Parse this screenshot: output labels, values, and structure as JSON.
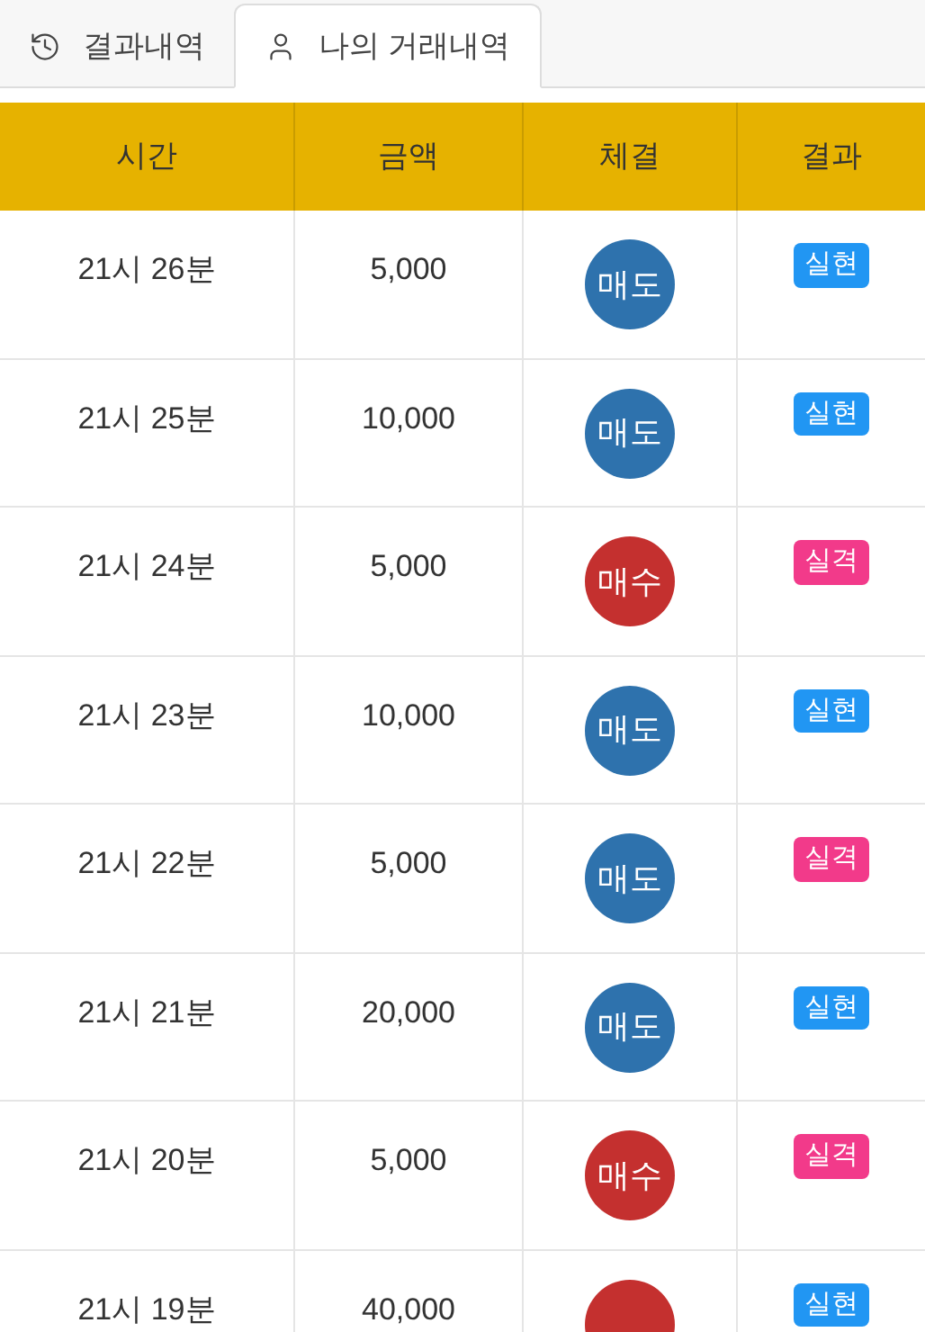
{
  "tabs": [
    {
      "label": "결과내역",
      "kind": "history",
      "selected": false
    },
    {
      "label": "나의 거래내역",
      "kind": "user",
      "selected": true
    }
  ],
  "table": {
    "columns": [
      "시간",
      "금액",
      "체결",
      "결과"
    ],
    "rows": [
      {
        "time": "21시 26분",
        "amount": "5,000",
        "trade": {
          "label": "매도",
          "kind": "sell"
        },
        "result": {
          "label": "실현",
          "kind": "hit"
        }
      },
      {
        "time": "21시 25분",
        "amount": "10,000",
        "trade": {
          "label": "매도",
          "kind": "sell"
        },
        "result": {
          "label": "실현",
          "kind": "hit"
        }
      },
      {
        "time": "21시 24분",
        "amount": "5,000",
        "trade": {
          "label": "매수",
          "kind": "buy"
        },
        "result": {
          "label": "실격",
          "kind": "miss"
        }
      },
      {
        "time": "21시 23분",
        "amount": "10,000",
        "trade": {
          "label": "매도",
          "kind": "sell"
        },
        "result": {
          "label": "실현",
          "kind": "hit"
        }
      },
      {
        "time": "21시 22분",
        "amount": "5,000",
        "trade": {
          "label": "매도",
          "kind": "sell"
        },
        "result": {
          "label": "실격",
          "kind": "miss"
        }
      },
      {
        "time": "21시 21분",
        "amount": "20,000",
        "trade": {
          "label": "매도",
          "kind": "sell"
        },
        "result": {
          "label": "실현",
          "kind": "hit"
        }
      },
      {
        "time": "21시 20분",
        "amount": "5,000",
        "trade": {
          "label": "매수",
          "kind": "buy"
        },
        "result": {
          "label": "실격",
          "kind": "miss"
        }
      },
      {
        "time": "21시 19분",
        "amount": "40,000",
        "trade": {
          "kind": "buy"
        },
        "result": {
          "label": "실현",
          "kind": "hit"
        }
      }
    ]
  }
}
